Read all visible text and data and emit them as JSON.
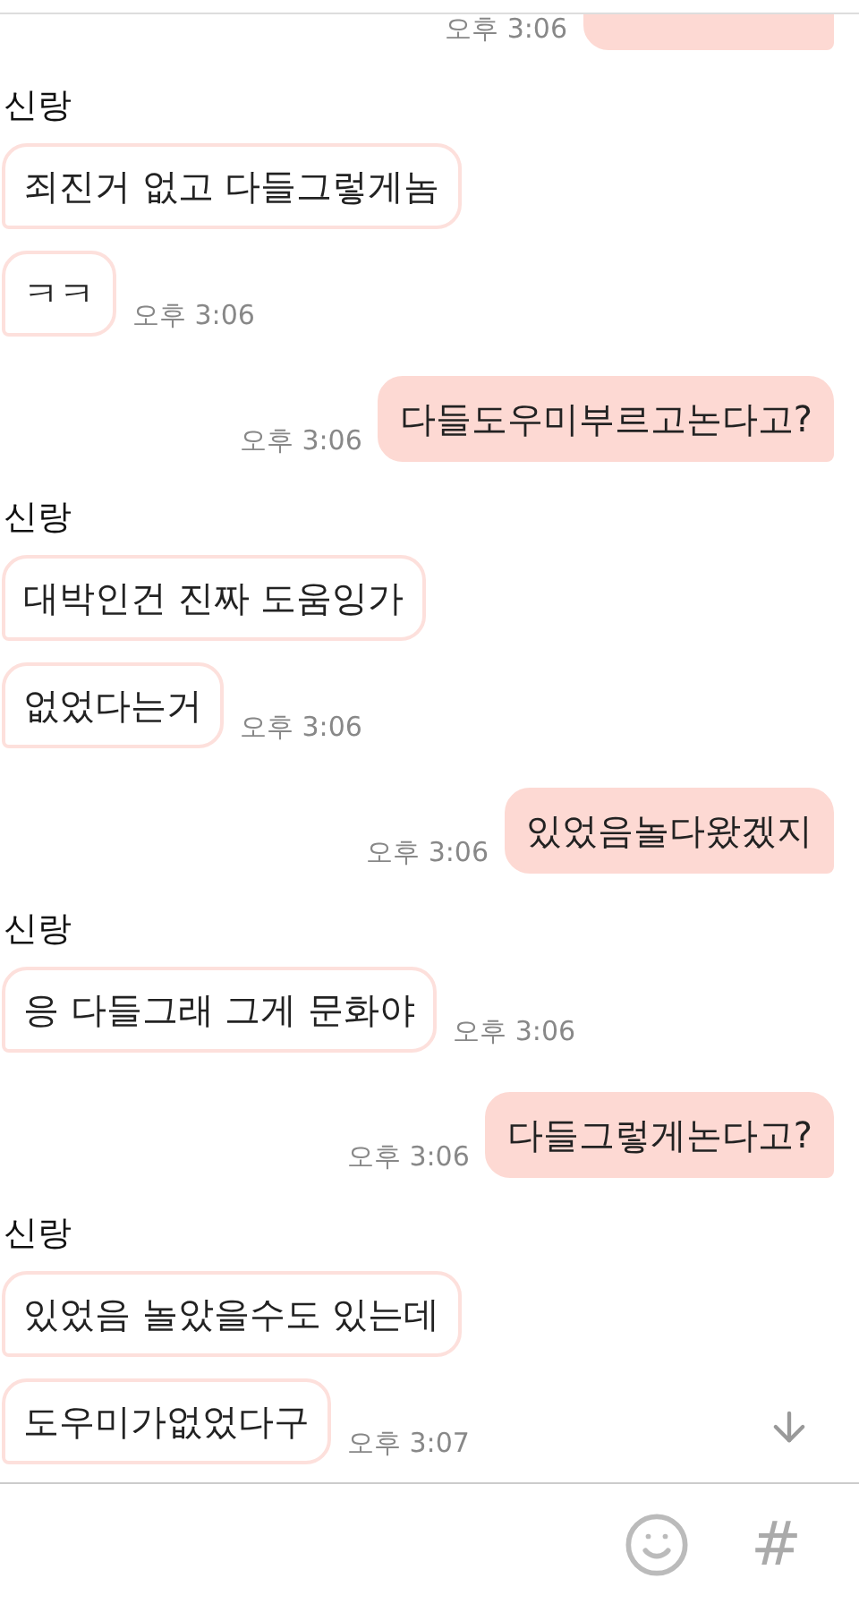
{
  "messages": [
    {
      "kind": "outgoing",
      "time": "오후 3:06"
    },
    {
      "kind": "sender",
      "name": "신랑"
    },
    {
      "kind": "incoming",
      "text": "죄진거 없고 다들그렇게놈"
    },
    {
      "kind": "incoming",
      "text": "ㅋㅋ",
      "time": "오후 3:06"
    },
    {
      "kind": "outgoing",
      "text": "다들도우미부르고논다고?",
      "time": "오후 3:06"
    },
    {
      "kind": "sender",
      "name": "신랑"
    },
    {
      "kind": "incoming",
      "text": "대박인건 진짜 도움잉가"
    },
    {
      "kind": "incoming",
      "text": "없었다는거",
      "time": "오후 3:06"
    },
    {
      "kind": "outgoing",
      "text": "있었음놀다왔겠지",
      "time": "오후 3:06"
    },
    {
      "kind": "sender",
      "name": "신랑"
    },
    {
      "kind": "incoming",
      "text": "응 다들그래 그게 문화야",
      "time": "오후 3:06"
    },
    {
      "kind": "outgoing",
      "text": "다들그렇게논다고?",
      "time": "오후 3:06"
    },
    {
      "kind": "sender",
      "name": "신랑"
    },
    {
      "kind": "incoming",
      "text": "있었음 놀았을수도 있는데"
    },
    {
      "kind": "incoming",
      "text": "도우미가없었다구",
      "time": "오후 3:07"
    }
  ],
  "input_bar": {
    "hashtag_button": "#"
  }
}
